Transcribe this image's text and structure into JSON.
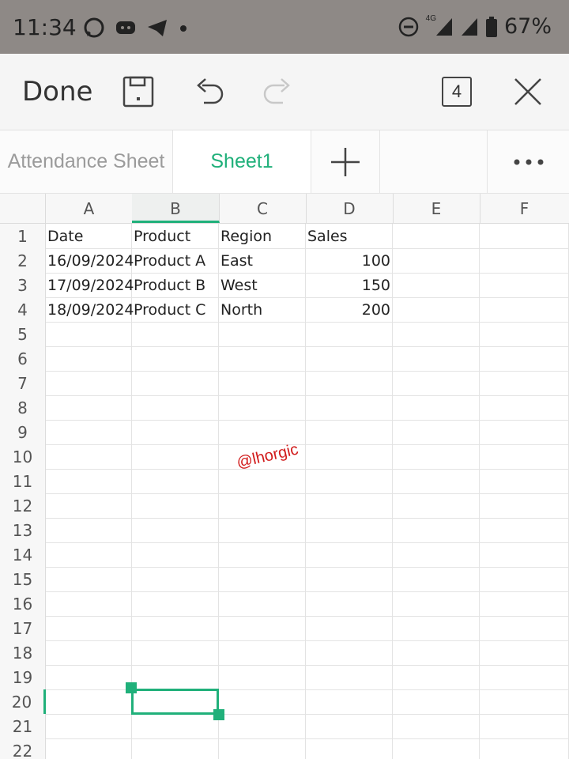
{
  "status_bar": {
    "time": "11:34",
    "network_label": "4G",
    "battery": "67%"
  },
  "toolbar": {
    "done_label": "Done",
    "sheet_count": "4"
  },
  "tabs": [
    {
      "label": "Attendance Sheet",
      "active": false
    },
    {
      "label": "Sheet1",
      "active": true
    }
  ],
  "columns": [
    "A",
    "B",
    "C",
    "D",
    "E",
    "F"
  ],
  "active_column": "B",
  "row_numbers": [
    "1",
    "2",
    "3",
    "4",
    "5",
    "6",
    "7",
    "8",
    "9",
    "10",
    "11",
    "12",
    "13",
    "14",
    "15",
    "16",
    "17",
    "18",
    "19",
    "20",
    "21",
    "22"
  ],
  "active_row": "20",
  "cells": [
    [
      "Date",
      "Product",
      "Region",
      "Sales",
      "",
      ""
    ],
    [
      "16/09/2024",
      "Product A",
      "East",
      "100",
      "",
      ""
    ],
    [
      "17/09/2024",
      "Product B",
      "West",
      "150",
      "",
      ""
    ],
    [
      "18/09/2024",
      "Product C",
      "North",
      "200",
      "",
      ""
    ]
  ],
  "watermark": "@lhorgic",
  "colors": {
    "accent": "#20b07a",
    "status_bar": "#8e8986",
    "watermark": "#d11a1a"
  }
}
